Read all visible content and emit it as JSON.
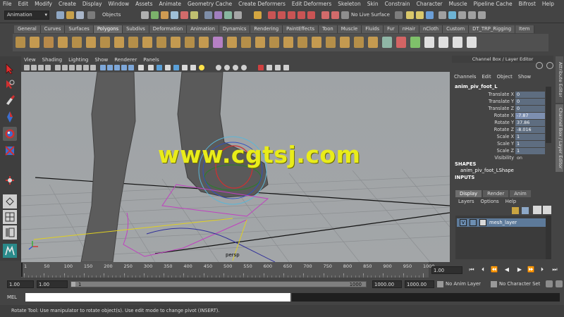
{
  "menubar": [
    "File",
    "Edit",
    "Modify",
    "Create",
    "Display",
    "Window",
    "Assets",
    "Animate",
    "Geometry Cache",
    "Create Deformers",
    "Edit Deformers",
    "Skeleton",
    "Skin",
    "Constrain",
    "Character",
    "Muscle",
    "Pipeline Cache",
    "Bifrost",
    "Help"
  ],
  "statusline": {
    "mode": "Animation",
    "objects_label": "Objects",
    "no_live_surface": "No Live Surface"
  },
  "shelf_tabs": [
    "General",
    "Curves",
    "Surfaces",
    "Polygons",
    "Subdivs",
    "Deformation",
    "Animation",
    "Dynamics",
    "Rendering",
    "PaintEffects",
    "Toon",
    "Muscle",
    "Fluids",
    "Fur",
    "nHair",
    "nCloth",
    "Custom",
    "DT_TRP_Rigging",
    "Item"
  ],
  "shelf_active_tab": "Polygons",
  "viewport": {
    "menu": [
      "View",
      "Shading",
      "Lighting",
      "Show",
      "Renderer",
      "Panels"
    ],
    "camera_label": "persp"
  },
  "channel_box": {
    "header": "Channel Box / Layer Editor",
    "menu": [
      "Channels",
      "Edit",
      "Object",
      "Show"
    ],
    "object_name": "anim_piv_foot_L",
    "attributes": [
      {
        "name": "Translate X",
        "value": "0"
      },
      {
        "name": "Translate Y",
        "value": "0"
      },
      {
        "name": "Translate Z",
        "value": "0"
      },
      {
        "name": "Rotate X",
        "value": "-7.87"
      },
      {
        "name": "Rotate Y",
        "value": "37.86"
      },
      {
        "name": "Rotate Z",
        "value": "-8.016"
      },
      {
        "name": "Scale X",
        "value": "1"
      },
      {
        "name": "Scale Y",
        "value": "1"
      },
      {
        "name": "Scale Z",
        "value": "1"
      },
      {
        "name": "Visibility",
        "value": "on"
      }
    ],
    "shapes_label": "SHAPES",
    "shape_name": "anim_piv_foot_LShape",
    "inputs_label": "INPUTS"
  },
  "side_tabs": {
    "attribute_editor": "Attribute Editor",
    "channel_box": "Channel Box / Layer Editor"
  },
  "layer_editor": {
    "tabs": [
      "Display",
      "Render",
      "Anim"
    ],
    "menu": [
      "Layers",
      "Options",
      "Help"
    ],
    "layer_visible": "V",
    "layer_name": "mesh_layer"
  },
  "time_slider": {
    "ticks": [
      "1",
      "50",
      "100",
      "150",
      "200",
      "250",
      "300",
      "350",
      "400",
      "450",
      "500",
      "550",
      "600",
      "650",
      "700",
      "750",
      "800",
      "850",
      "900",
      "950",
      "1000"
    ],
    "current_frame": "1.00"
  },
  "range": {
    "start": "1.00",
    "playback_start": "1.00",
    "slider_start": "1",
    "slider_end": "1000",
    "playback_end": "1000.00",
    "end": "1000.00",
    "anim_layer": "No Anim Layer",
    "character_set": "No Character Set"
  },
  "command_line": {
    "label": "MEL"
  },
  "help_line": "Rotate Tool: Use manipulator to rotate object(s). Use edit mode to change pivot (INSERT).",
  "watermark": "www.cgtsj.com"
}
